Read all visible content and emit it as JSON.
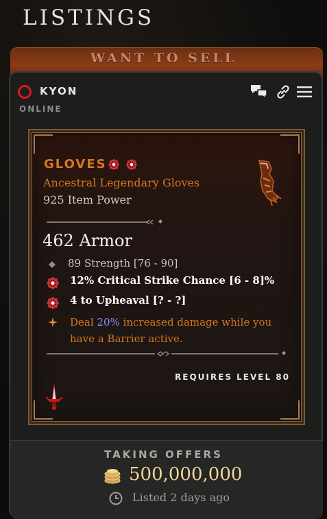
{
  "page": {
    "title": "LISTINGS"
  },
  "tab": {
    "label": "WANT TO SELL"
  },
  "seller": {
    "name": "KYON",
    "status": "ONLINE"
  },
  "header_icons": [
    "chat-icon",
    "link-icon",
    "menu-icon"
  ],
  "item": {
    "name": "GLOVES",
    "type": "Ancestral Legendary Gloves",
    "power": "925 Item Power",
    "armor": "462 Armor",
    "affixes": [
      {
        "text": "89 Strength [76 - 90]",
        "style": "plain"
      },
      {
        "text": "12% Critical Strike Chance [6 - 8]%",
        "style": "greater"
      },
      {
        "text": "4 to Upheaval [? - ?]",
        "style": "greater"
      }
    ],
    "legendary_power": {
      "prefix": "Deal ",
      "value": "20%",
      "line1_suffix": " increased damage while you",
      "line2": "have a Barrier active."
    },
    "requirement": "REQUIRES LEVEL 80"
  },
  "offer": {
    "label": "TAKING OFFERS",
    "price": "500,000,000",
    "listed": "Listed 2 days ago"
  },
  "colors": {
    "legendary": "#d6781f",
    "greater_affix": "#e0323a",
    "gold": "#f0d79a",
    "value_highlight": "#8f8fff"
  }
}
